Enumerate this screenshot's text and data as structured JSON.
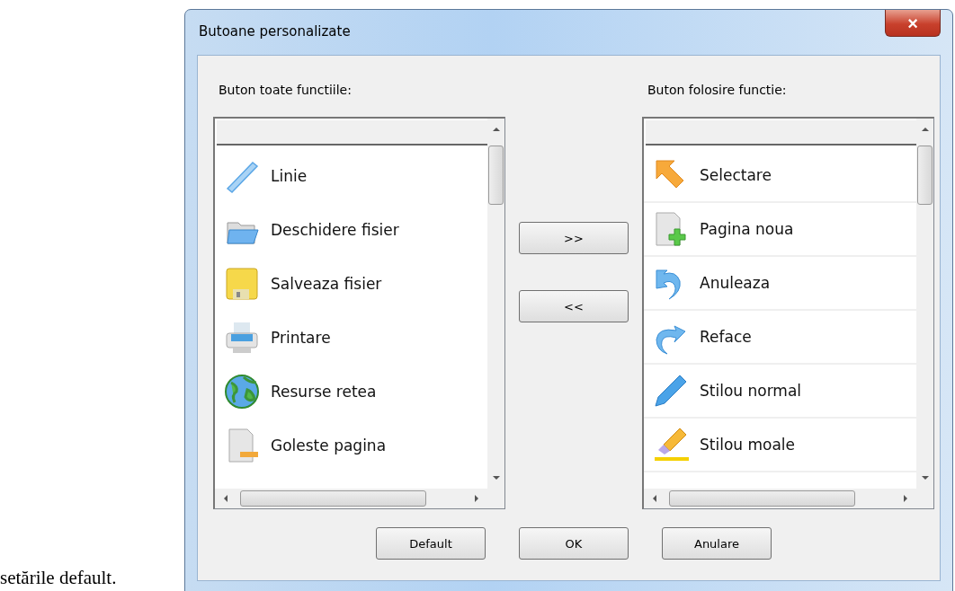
{
  "document": {
    "trailing_text": "setările default."
  },
  "window": {
    "title": "Butoane personalizate",
    "close": "×"
  },
  "lists": [
    {
      "label": "Buton toate functiile:",
      "items": [
        {
          "label": "Linie"
        },
        {
          "label": "Deschidere fisier"
        },
        {
          "label": "Salveaza fisier"
        },
        {
          "label": "Printare"
        },
        {
          "label": "Resurse retea"
        },
        {
          "label": "Goleste pagina"
        }
      ]
    },
    {
      "label": "Buton folosire functie:",
      "items": [
        {
          "label": "Selectare"
        },
        {
          "label": "Pagina noua"
        },
        {
          "label": "Anuleaza"
        },
        {
          "label": "Reface"
        },
        {
          "label": "Stilou normal"
        },
        {
          "label": "Stilou moale"
        }
      ]
    }
  ],
  "move_buttons": [
    ">>",
    "<<"
  ],
  "buttons": [
    "Default",
    "OK",
    "Anulare"
  ]
}
